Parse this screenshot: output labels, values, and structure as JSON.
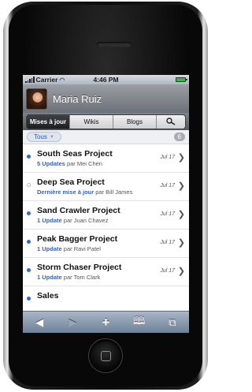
{
  "status": {
    "carrier": "Carrier",
    "time": "4:46 PM",
    "battery_level": 1.0
  },
  "profile": {
    "name": "Maria Ruiz"
  },
  "tabs": [
    {
      "label": "Mises à jour",
      "active": true
    },
    {
      "label": "Wikis",
      "active": false
    },
    {
      "label": "Blogs",
      "active": false
    }
  ],
  "filter": {
    "label": "Tous",
    "count": "6"
  },
  "items": [
    {
      "title": "South Seas Project",
      "updates": "5 Updates",
      "by": "par Mei Chen",
      "date": "Jul 17",
      "unread": true
    },
    {
      "title": "Deep Sea Project",
      "updates": "Dernière mise à jour",
      "by": "par Bill James",
      "date": "Jul 17",
      "unread": false
    },
    {
      "title": "Sand Crawler Project",
      "updates": "1 Update",
      "by": "par Juan Chavez",
      "date": "Jul 17",
      "unread": true
    },
    {
      "title": "Peak Bagger Project",
      "updates": "1 Update",
      "by": "par Ravi Patel",
      "date": "Jul 17",
      "unread": true
    },
    {
      "title": "Storm Chaser Project",
      "updates": "1 Update",
      "by": "par Tom Clark",
      "date": "Jul 17",
      "unread": true
    },
    {
      "title": "Sales",
      "updates": "",
      "by": "",
      "date": "",
      "unread": true
    }
  ],
  "toolbar": {
    "back": "◀",
    "forward": "▶",
    "add": "+",
    "bookmarks": "🕮",
    "pages": "⧉"
  },
  "colors": {
    "accent": "#2f64c4",
    "active_tab": "#1d1e21",
    "toolbar": "#8a9bb0"
  }
}
